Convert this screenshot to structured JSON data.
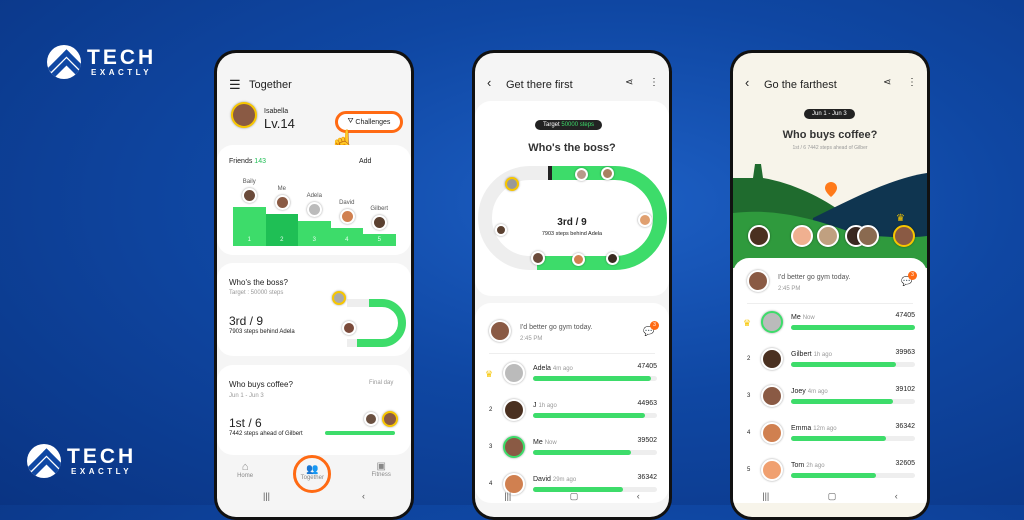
{
  "brand": {
    "logo_text": "TECH",
    "logo_sub": "EXACTLY"
  },
  "colors": {
    "accent": "#3ddc6a",
    "accent_dark": "#1fbf55",
    "highlight": "#ff6a13",
    "background": "#0f47a3",
    "crown": "#f7c600"
  },
  "phone1": {
    "header": {
      "title": "Together",
      "menu_icon": "hamburger-icon"
    },
    "profile": {
      "name": "Isabella",
      "level": "Lv.14"
    },
    "challenges_button": "Challenges",
    "step_marker": "2",
    "friends": {
      "label": "Friends",
      "count": "143",
      "add": "Add",
      "podium": [
        {
          "name": "Baily",
          "rank": "1"
        },
        {
          "name": "Me",
          "rank": "2"
        },
        {
          "name": "Adela",
          "rank": "3"
        },
        {
          "name": "David",
          "rank": "4"
        },
        {
          "name": "Gilbert",
          "rank": "5"
        }
      ]
    },
    "boss_card": {
      "title": "Who's the boss?",
      "target": "Target : 50000 steps",
      "rank": "3rd / 9",
      "detail": "7903 steps behind Adela"
    },
    "coffee_card": {
      "title": "Who buys coffee?",
      "status": "Final day",
      "dates": "Jun 1 - Jun 3",
      "rank": "1st / 6",
      "detail": "7442 steps ahead of Gilbert"
    },
    "bottom_nav": [
      {
        "label": "Home",
        "icon": "home-icon"
      },
      {
        "label": "Together",
        "icon": "people-icon"
      },
      {
        "label": "Fitness",
        "icon": "fitness-icon"
      }
    ]
  },
  "phone2": {
    "header": {
      "title": "Get there first"
    },
    "target_label": "Target",
    "target_value": "50000 steps",
    "title": "Who's the boss?",
    "rank": "3rd / 9",
    "detail": "7903 steps behind Adela",
    "message": {
      "text": "I'd better go gym today.",
      "time": "2:45 PM",
      "badge": "3"
    },
    "target_steps": 50000,
    "leaderboard": [
      {
        "rank": "",
        "crown": true,
        "name": "Adela",
        "time": "4m ago",
        "steps": "47405",
        "value": 47405
      },
      {
        "rank": "2",
        "name": "J",
        "time": "1h ago",
        "steps": "44963",
        "value": 44963
      },
      {
        "rank": "3",
        "name": "Me",
        "time": "Now",
        "steps": "39502",
        "value": 39502,
        "me": true
      },
      {
        "rank": "4",
        "name": "David",
        "time": "29m ago",
        "steps": "36342",
        "value": 36342
      }
    ]
  },
  "phone3": {
    "header": {
      "title": "Go the farthest"
    },
    "dates": "Jun 1 - Jun 3",
    "title": "Who buys coffee?",
    "subtitle": "1st / 6  7442 steps ahead of Gilber",
    "message": {
      "text": "I'd better go gym today.",
      "time": "2:45 PM",
      "badge": "3"
    },
    "leaderboard": [
      {
        "rank": "",
        "crown": true,
        "name": "Me",
        "time": "Now",
        "steps": "47405",
        "value": 47405,
        "me": true
      },
      {
        "rank": "2",
        "name": "Gilbert",
        "time": "1h ago",
        "steps": "39963",
        "value": 39963
      },
      {
        "rank": "3",
        "name": "Joey",
        "time": "4m ago",
        "steps": "39102",
        "value": 39102
      },
      {
        "rank": "4",
        "name": "Emma",
        "time": "12m ago",
        "steps": "36342",
        "value": 36342
      },
      {
        "rank": "5",
        "name": "Tom",
        "time": "2h ago",
        "steps": "32605",
        "value": 32605
      }
    ]
  }
}
